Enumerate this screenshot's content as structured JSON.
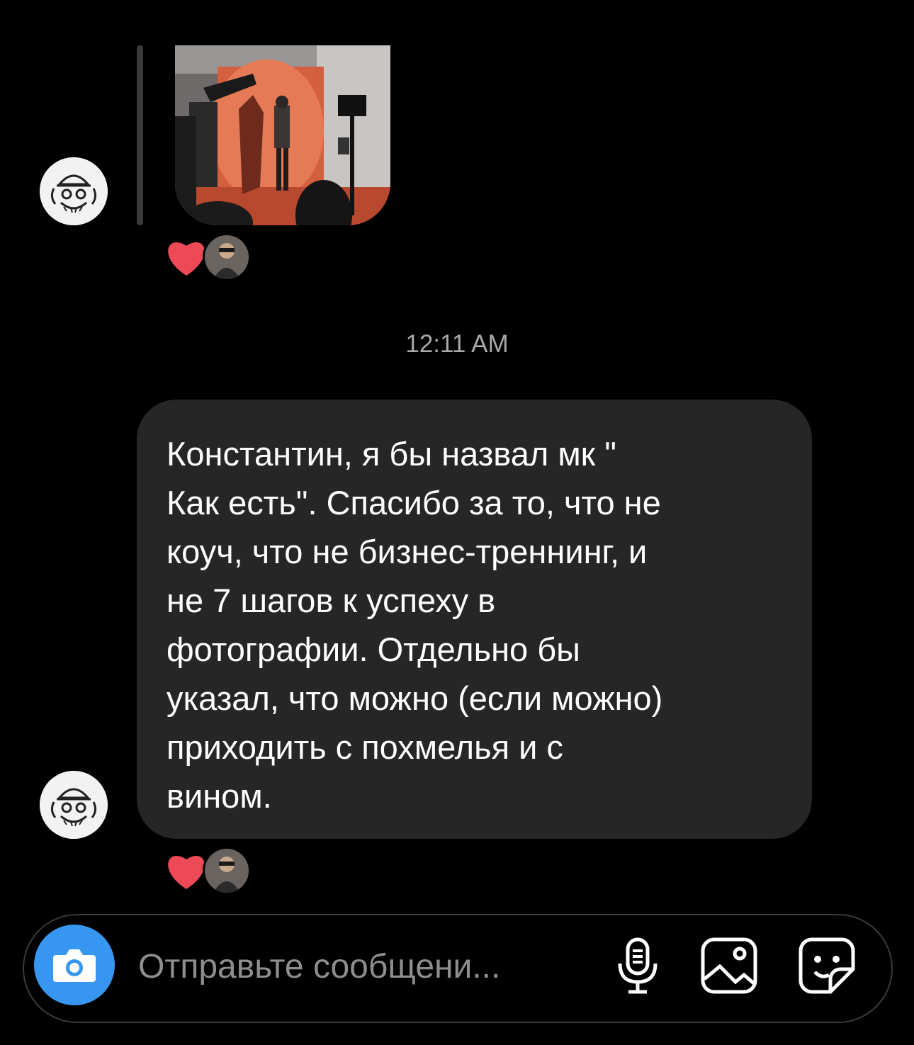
{
  "thread": {
    "shared_photo": {
      "description_icon": "photo-studio-image"
    },
    "first_reaction": {
      "emoji_icon": "heart-icon",
      "emoji_color": "#ed4956"
    },
    "timestamp": "12:11 AM",
    "message": {
      "text": "Константин, я бы назвал мк \"\nКак есть\". Спасибо за то, что не\nкоуч, что не бизнес-треннинг, и\nне 7 шагов к успеху в\nфотографии. Отдельно бы\nуказал, что можно (если можно)\nприходить с похмелья и с\nвином.",
      "bubble_color": "#262626"
    },
    "second_reaction": {
      "emoji_icon": "heart-icon",
      "emoji_color": "#ed4956"
    }
  },
  "composer": {
    "placeholder": "Отправьте сообщени...",
    "camera_icon": "camera-icon",
    "camera_color": "#3797f0",
    "mic_icon": "microphone-icon",
    "gallery_icon": "gallery-icon",
    "sticker_icon": "sticker-icon"
  }
}
